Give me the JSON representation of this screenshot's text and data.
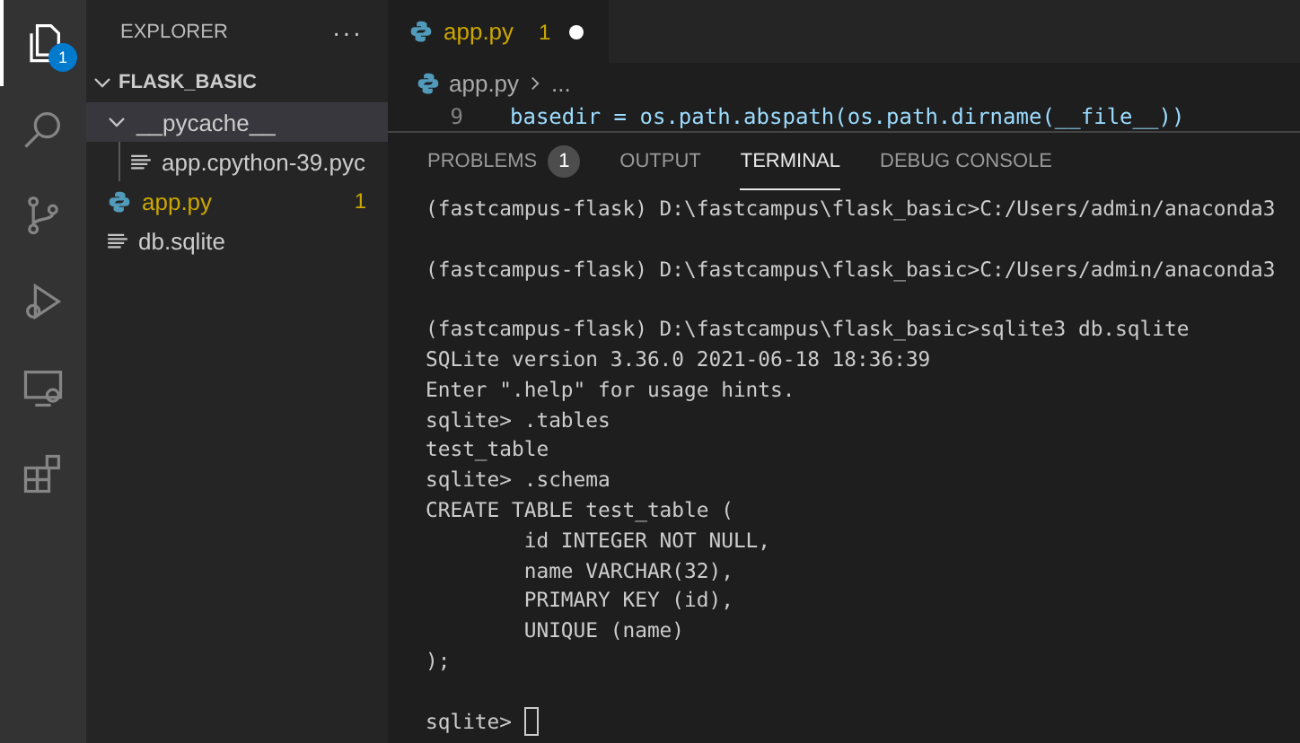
{
  "activity_bar": [
    {
      "kind": "files",
      "selected": true,
      "badge": "1"
    },
    {
      "kind": "search",
      "selected": false
    },
    {
      "kind": "source-control",
      "selected": false
    },
    {
      "kind": "debug",
      "selected": false
    },
    {
      "kind": "remote",
      "selected": false
    },
    {
      "kind": "extensions",
      "selected": false
    }
  ],
  "sidebar": {
    "title": "EXPLORER",
    "more": "···",
    "folder": {
      "name": "FLASK_BASIC",
      "expanded": true,
      "children": [
        {
          "name": "__pycache__",
          "kind": "folder",
          "expanded": true,
          "selected": true,
          "children": [
            {
              "name": "app.cpython-39.pyc",
              "kind": "file",
              "selected": false
            }
          ]
        },
        {
          "name": "app.py",
          "kind": "python",
          "selected": false,
          "problems": "1"
        },
        {
          "name": "db.sqlite",
          "kind": "file",
          "selected": false
        }
      ]
    }
  },
  "editor_tabs": [
    {
      "label": "app.py",
      "problems": "1",
      "modified": true,
      "selected": true
    }
  ],
  "breadcrumb": {
    "file": "app.py",
    "rest": "..."
  },
  "code_line": {
    "number": "9",
    "text": "basedir = os.path.abspath(os.path.dirname(__file__))"
  },
  "panel_tabs": [
    {
      "label": "PROBLEMS",
      "badge": "1",
      "selected": false
    },
    {
      "label": "OUTPUT",
      "selected": false
    },
    {
      "label": "TERMINAL",
      "selected": true
    },
    {
      "label": "DEBUG CONSOLE",
      "selected": false
    }
  ],
  "terminal": {
    "blocks": [
      [
        "(fastcampus-flask) D:\\fastcampus\\flask_basic>C:/Users/admin/anaconda3"
      ],
      [
        "(fastcampus-flask) D:\\fastcampus\\flask_basic>C:/Users/admin/anaconda3"
      ],
      [
        "(fastcampus-flask) D:\\fastcampus\\flask_basic>sqlite3 db.sqlite",
        "SQLite version 3.36.0 2021-06-18 18:36:39",
        "Enter \".help\" for usage hints.",
        "sqlite> .tables",
        "test_table",
        "sqlite> .schema",
        "CREATE TABLE test_table (",
        "        id INTEGER NOT NULL,",
        "        name VARCHAR(32),",
        "        PRIMARY KEY (id),",
        "        UNIQUE (name)",
        ");"
      ]
    ],
    "prompt": "sqlite>"
  }
}
